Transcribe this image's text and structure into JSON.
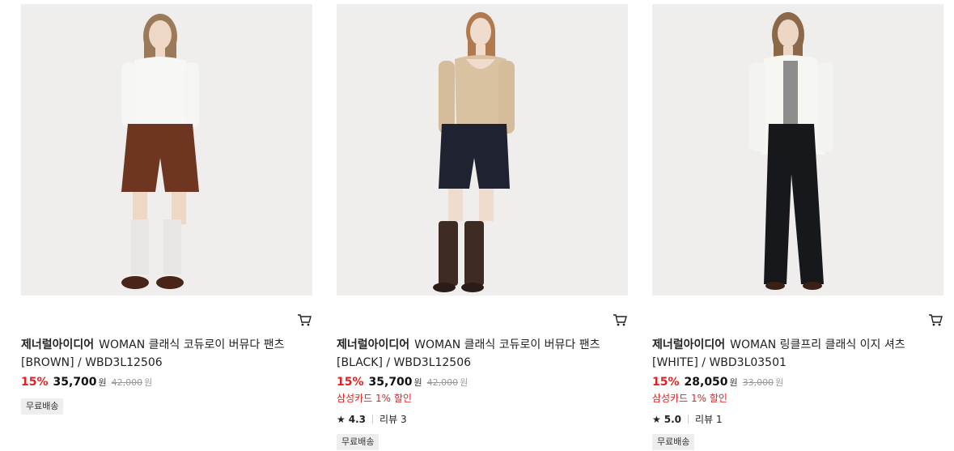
{
  "products": [
    {
      "brand": "제너럴아이디어",
      "name": "WOMAN 클래식 코듀로이 버뮤다 팬츠",
      "option": "[BROWN] / WBD3L12506",
      "discount": "15%",
      "price": "35,700",
      "currency": "원",
      "original_price": "42,000",
      "original_currency": "원",
      "badge": "무료배송",
      "cart_icon": "cart-icon"
    },
    {
      "brand": "제너럴아이디어",
      "name": "WOMAN 클래식 코듀로이 버뮤다 팬츠",
      "option": "[BLACK] / WBD3L12506",
      "discount": "15%",
      "price": "35,700",
      "currency": "원",
      "original_price": "42,000",
      "original_currency": "원",
      "promo": "삼성카드 1% 할인",
      "rating": "4.3",
      "review_label": "리뷰",
      "review_count": "3",
      "badge": "무료배송",
      "cart_icon": "cart-icon"
    },
    {
      "brand": "제너럴아이디어",
      "name": "WOMAN 링클프리 클래식 이지 셔츠",
      "option": "[WHITE] / WBD3L03501",
      "discount": "15%",
      "price": "28,050",
      "currency": "원",
      "original_price": "33,000",
      "original_currency": "원",
      "promo": "삼성카드 1% 할인",
      "rating": "5.0",
      "review_label": "리뷰",
      "review_count": "1",
      "badge": "무료배송",
      "cart_icon": "cart-icon"
    }
  ],
  "colors": {
    "discount": "#e32020",
    "badge_bg": "#eeeeee",
    "image_bg": "#efeeed"
  }
}
